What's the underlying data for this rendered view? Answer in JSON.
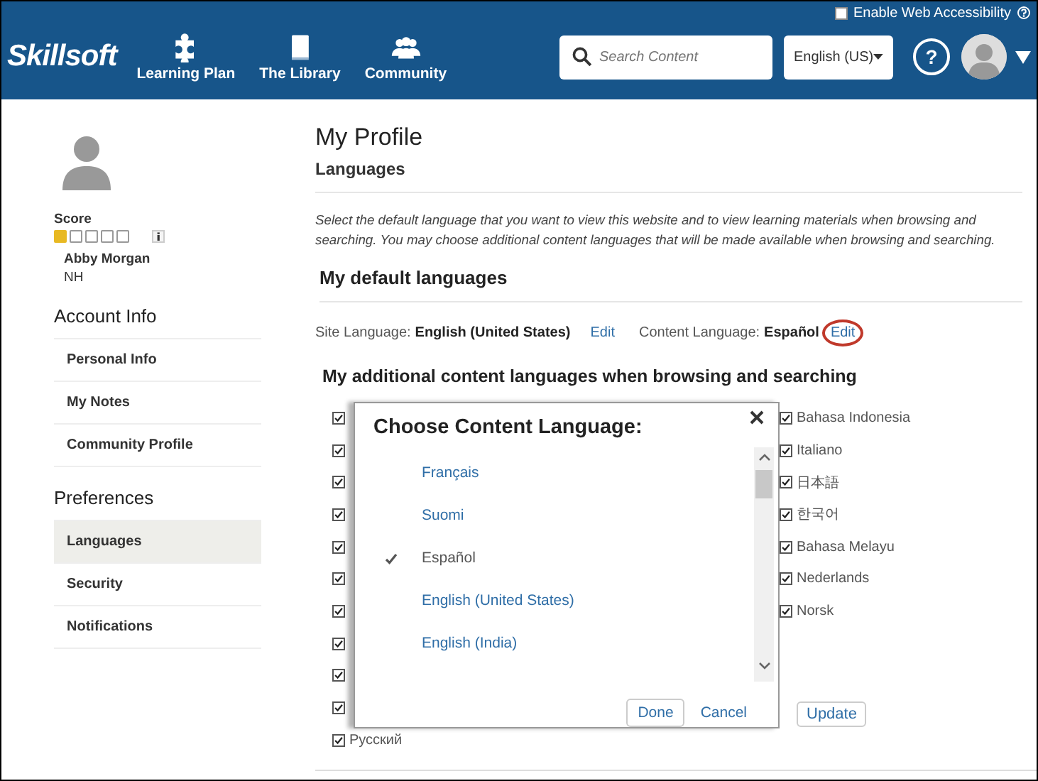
{
  "header": {
    "accessibility": {
      "label": "Enable Web Accessibility",
      "checked": false
    },
    "logo": "Skillsoft",
    "nav": [
      {
        "label": "Learning Plan",
        "kind": "puzzle"
      },
      {
        "label": "The Library",
        "kind": "book"
      },
      {
        "label": "Community",
        "kind": "people"
      }
    ],
    "search": {
      "placeholder": "Search Content"
    },
    "language_select": {
      "value": "English (US)"
    },
    "help": "?"
  },
  "sidebar": {
    "score_label": "Score",
    "stars": 1,
    "name": "Abby Morgan",
    "initials": "NH",
    "sections": [
      {
        "title": "Account Info",
        "items": [
          {
            "label": "Personal Info",
            "selected": false
          },
          {
            "label": "My Notes",
            "selected": false
          },
          {
            "label": "Community Profile",
            "selected": false
          }
        ]
      },
      {
        "title": "Preferences",
        "items": [
          {
            "label": "Languages",
            "selected": true
          },
          {
            "label": "Security",
            "selected": false
          },
          {
            "label": "Notifications",
            "selected": false
          }
        ]
      }
    ]
  },
  "main": {
    "title": "My Profile",
    "subtitle": "Languages",
    "description": "Select the default language that you want to view this website and to view learning materials when browsing and searching. You may choose additional content languages that will be made available when browsing and searching.",
    "default_heading": "My default languages",
    "site_language": {
      "label": "Site Language:",
      "value": "English (United States)",
      "edit": "Edit",
      "highlighted": false
    },
    "content_language": {
      "label": "Content Language:",
      "value": "Español",
      "edit": "Edit",
      "highlighted": true
    },
    "additional_heading": "My additional content languages when browsing and searching",
    "languages_left": [
      {
        "checked": true
      },
      {
        "checked": true
      },
      {
        "checked": true
      },
      {
        "checked": true
      },
      {
        "checked": true
      },
      {
        "checked": true
      },
      {
        "checked": true
      },
      {
        "checked": true
      },
      {
        "checked": true
      },
      {
        "checked": true
      },
      {
        "label": "Русский",
        "checked": true
      }
    ],
    "languages_right": [
      {
        "label": "Bahasa Indonesia",
        "checked": true
      },
      {
        "label": "Italiano",
        "checked": true
      },
      {
        "label": "日本語",
        "checked": true
      },
      {
        "label": "한국어",
        "checked": true
      },
      {
        "label": "Bahasa Melayu",
        "checked": true
      },
      {
        "label": "Nederlands",
        "checked": true
      },
      {
        "label": "Norsk",
        "checked": true
      }
    ],
    "update_button": "Update"
  },
  "modal": {
    "title": "Choose Content Language:",
    "options": [
      {
        "label": "Français",
        "selected": false
      },
      {
        "label": "Suomi",
        "selected": false
      },
      {
        "label": "Español",
        "selected": true
      },
      {
        "label": "English (United States)",
        "selected": false
      },
      {
        "label": "English (India)",
        "selected": false
      }
    ],
    "done": "Done",
    "cancel": "Cancel"
  }
}
